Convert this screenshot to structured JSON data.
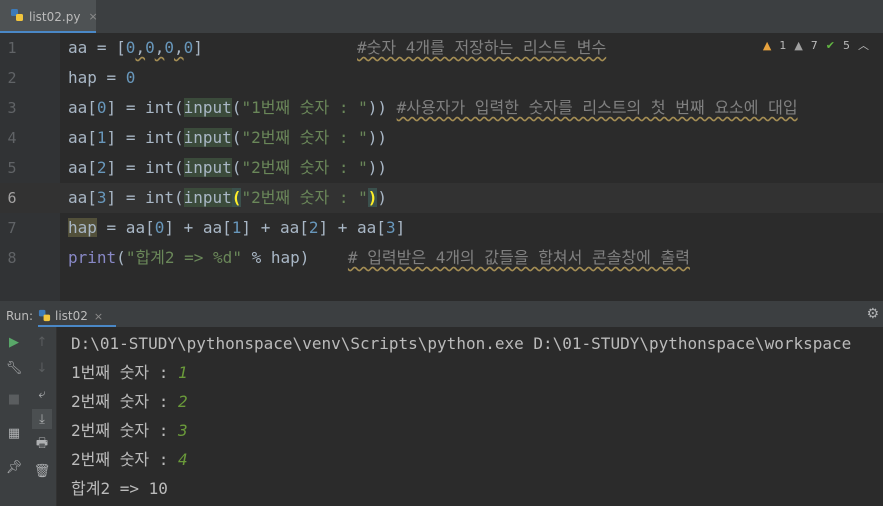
{
  "editor_tab": {
    "file_name": "list02.py",
    "close": "×"
  },
  "inspections": {
    "warnings": "1",
    "weak_warnings": "7",
    "ok": "5"
  },
  "code": {
    "line_numbers": [
      "1",
      "2",
      "3",
      "4",
      "5",
      "6",
      "7",
      "8"
    ],
    "l1": {
      "a": "aa = [",
      "b": "0",
      "c": ",",
      "d": "0",
      "e": ",",
      "f": "0",
      "g": ",",
      "h": "0",
      "i": "]",
      "pad": "                ",
      "comment": "#숫자 4개를 저장하는 리스트 변수"
    },
    "l2": {
      "a": "hap = ",
      "b": "0"
    },
    "l3": {
      "a": "aa[",
      "b": "0",
      "c": "] = ",
      "d": "int",
      "e": "(",
      "f": "input",
      "g": "(",
      "h": "\"1번째 숫자 : \"",
      "i": "))",
      "pad": " ",
      "comment": "#사용자가 입력한 숫자를 리스트의 첫 번째 요소에 대입"
    },
    "l4": {
      "a": "aa[",
      "b": "1",
      "c": "] = ",
      "d": "int",
      "e": "(",
      "f": "input",
      "g": "(",
      "h": "\"2번째 숫자 : \"",
      "i": "))"
    },
    "l5": {
      "a": "aa[",
      "b": "2",
      "c": "] = ",
      "d": "int",
      "e": "(",
      "f": "input",
      "g": "(",
      "h": "\"2번째 숫자 : \"",
      "i": "))"
    },
    "l6": {
      "a": "aa[",
      "b": "3",
      "c": "] = ",
      "d": "int",
      "e": "(",
      "f": "input",
      "g": "(",
      "h": "\"2번째 숫자 : \"",
      "i": ")",
      "j": ")"
    },
    "l7": {
      "a": "hap",
      "b": " = aa[",
      "c": "0",
      "d": "] + aa[",
      "e": "1",
      "f": "] + aa[",
      "g": "2",
      "h": "] + aa[",
      "i": "3",
      "j": "]"
    },
    "l8": {
      "a": "print",
      "b": "(",
      "c": "\"합계2 => %d\"",
      "d": " % hap)",
      "pad": "    ",
      "comment": "# 입력받은 4개의 값들을 합쳐서 콘솔창에 출력"
    }
  },
  "run_panel": {
    "label": "Run:",
    "tab_name": "list02",
    "close": "×",
    "console": {
      "command": "D:\\01-STUDY\\pythonspace\\venv\\Scripts\\python.exe D:\\01-STUDY\\pythonspace\\workspace",
      "lines": [
        {
          "prompt": "1번째 숫자 : ",
          "input": "1"
        },
        {
          "prompt": "2번째 숫자 : ",
          "input": "2"
        },
        {
          "prompt": "2번째 숫자 : ",
          "input": "3"
        },
        {
          "prompt": "2번째 숫자 : ",
          "input": "4"
        }
      ],
      "result": "합계2 => 10"
    }
  },
  "colors": {
    "background": "#2b2b2b",
    "keyword_default": "#a9b7c6",
    "number": "#6897bb",
    "string": "#6a8759",
    "comment": "#808080",
    "accent": "#4a88c7"
  }
}
